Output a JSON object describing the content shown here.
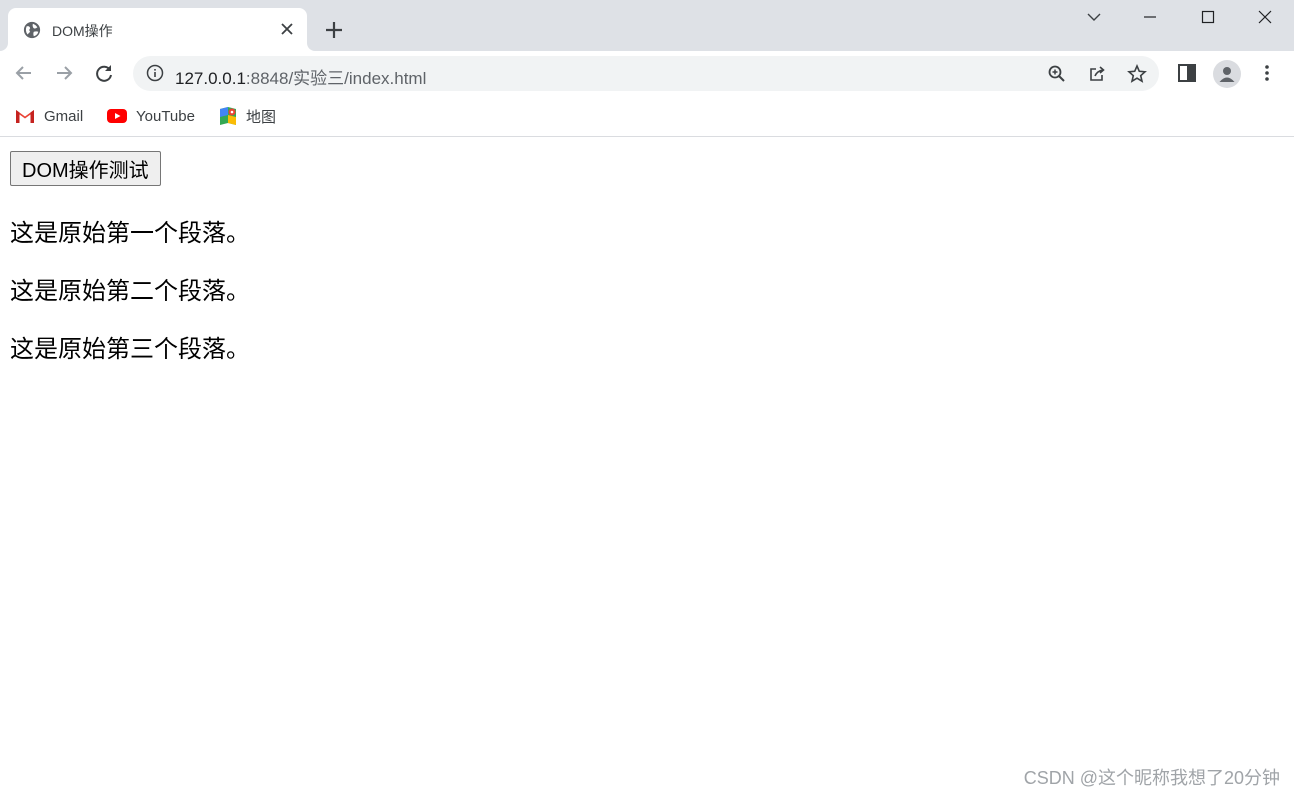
{
  "tab": {
    "title": "DOM操作",
    "favicon": "globe-icon",
    "close_icon": "close-icon"
  },
  "window_controls": [
    "chevron-down-icon",
    "minimize-icon",
    "maximize-icon",
    "close-icon"
  ],
  "toolbar": {
    "back": "back-arrow-icon",
    "forward": "forward-arrow-icon",
    "reload": "reload-icon",
    "url_host": "127.0.0.1",
    "url_rest": ":8848/实验三/index.html",
    "omnibox_icons": [
      "zoom-icon",
      "share-icon",
      "star-icon"
    ],
    "side_panel": "side-panel-icon",
    "profile": "profile-icon",
    "menu": "kebab-menu-icon"
  },
  "bookmarks": [
    {
      "label": "Gmail",
      "icon": "gmail-icon"
    },
    {
      "label": "YouTube",
      "icon": "youtube-icon"
    },
    {
      "label": "地图",
      "icon": "maps-icon"
    }
  ],
  "page": {
    "button_label": "DOM操作测试",
    "paragraphs": [
      "这是原始第一个段落。",
      "这是原始第二个段落。",
      "这是原始第三个段落。"
    ]
  },
  "watermark": "CSDN @这个昵称我想了20分钟",
  "colors": {
    "tabstrip": "#dee1e6",
    "omnibox": "#f1f3f4",
    "youtube_red": "#ff0000"
  }
}
